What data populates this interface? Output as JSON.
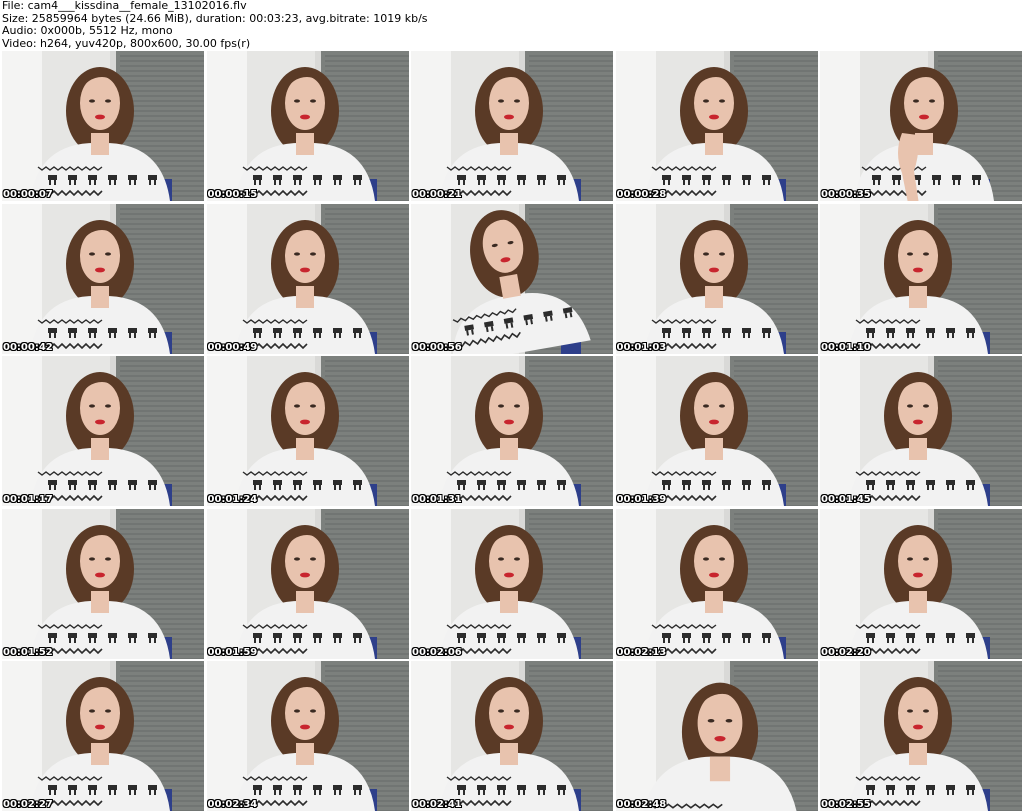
{
  "header": {
    "file_line": "File: cam4___kissdina__female_13102016.flv",
    "size_line": "Size: 25859964 bytes (24.66 MiB), duration: 00:03:23, avg.bitrate: 1019 kb/s",
    "audio_line": "Audio: 0x000b, 5512 Hz, mono",
    "video_line": "Video: h264, yuv420p, 800x600, 30.00 fps(r)"
  },
  "thumbnails": [
    {
      "timestamp": "00:00:07",
      "pose": "center"
    },
    {
      "timestamp": "00:00:15",
      "pose": "center"
    },
    {
      "timestamp": "00:00:21",
      "pose": "center"
    },
    {
      "timestamp": "00:00:28",
      "pose": "center"
    },
    {
      "timestamp": "00:00:35",
      "pose": "hand"
    },
    {
      "timestamp": "00:00:42",
      "pose": "center"
    },
    {
      "timestamp": "00:00:49",
      "pose": "center"
    },
    {
      "timestamp": "00:00:56",
      "pose": "tilted"
    },
    {
      "timestamp": "00:01:03",
      "pose": "center"
    },
    {
      "timestamp": "00:01:10",
      "pose": "center"
    },
    {
      "timestamp": "00:01:17",
      "pose": "center"
    },
    {
      "timestamp": "00:01:24",
      "pose": "center"
    },
    {
      "timestamp": "00:01:31",
      "pose": "center"
    },
    {
      "timestamp": "00:01:39",
      "pose": "center"
    },
    {
      "timestamp": "00:01:45",
      "pose": "center"
    },
    {
      "timestamp": "00:01:52",
      "pose": "center"
    },
    {
      "timestamp": "00:01:59",
      "pose": "center"
    },
    {
      "timestamp": "00:02:06",
      "pose": "center"
    },
    {
      "timestamp": "00:02:13",
      "pose": "center"
    },
    {
      "timestamp": "00:02:20",
      "pose": "center"
    },
    {
      "timestamp": "00:02:27",
      "pose": "center"
    },
    {
      "timestamp": "00:02:34",
      "pose": "center"
    },
    {
      "timestamp": "00:02:41",
      "pose": "center"
    },
    {
      "timestamp": "00:02:48",
      "pose": "close"
    },
    {
      "timestamp": "00:02:55",
      "pose": "center"
    }
  ],
  "colors": {
    "wall_left": "#e6e6e4",
    "blinds": "#7c807d",
    "blinds_dark": "#5e6260",
    "hair": "#5a3a26",
    "skin": "#e8c3ae",
    "lips": "#c8252e",
    "sweater": "#f2f2f2",
    "sweater_pattern": "#2c2c2c",
    "chair": "#2e3f8a"
  }
}
